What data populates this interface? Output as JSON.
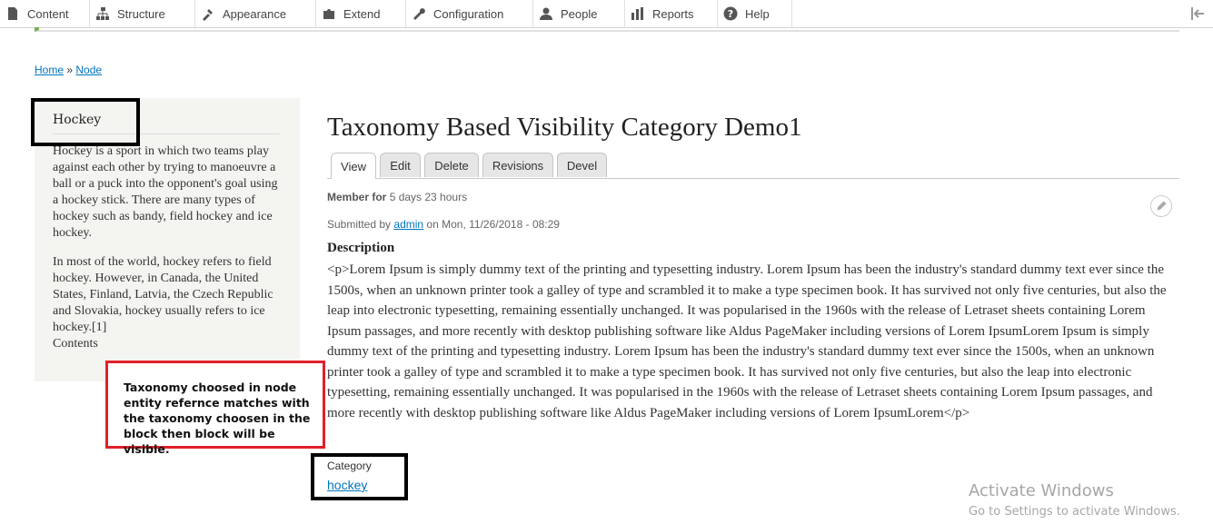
{
  "toolbar": {
    "items": [
      {
        "label": "Content",
        "icon": "file-icon"
      },
      {
        "label": "Structure",
        "icon": "sitemap-icon"
      },
      {
        "label": "Appearance",
        "icon": "paint-icon"
      },
      {
        "label": "Extend",
        "icon": "puzzle-icon"
      },
      {
        "label": "Configuration",
        "icon": "wrench-icon"
      },
      {
        "label": "People",
        "icon": "person-icon"
      },
      {
        "label": "Reports",
        "icon": "bar-chart-icon"
      },
      {
        "label": "Help",
        "icon": "help-icon"
      }
    ]
  },
  "breadcrumb": {
    "home": "Home",
    "sep": "»",
    "node": "Node"
  },
  "sidebar": {
    "title": "Hockey",
    "para1": "Hockey is a sport in which two teams play against each other by trying to manoeuvre a ball or a puck into the opponent's goal using a hockey stick. There are many types of hockey such as bandy, field hockey and ice hockey.",
    "para2": "In most of the world, hockey refers to field hockey. However, in Canada, the United States, Finland, Latvia, the Czech Republic and Slovakia, hockey usually refers to ice hockey.[1]",
    "contents": "Contents"
  },
  "page": {
    "title": "Taxonomy Based Visibility Category Demo1"
  },
  "tabs": [
    "View",
    "Edit",
    "Delete",
    "Revisions",
    "Devel"
  ],
  "meta": {
    "member_label": "Member for",
    "member_value": "5 days 23 hours",
    "submitted_prefix": "Submitted by",
    "author": "admin",
    "submitted_suffix": "on Mon, 11/26/2018 - 08:29"
  },
  "description": {
    "label": "Description",
    "body": "<p>Lorem Ipsum is simply dummy text of the printing and typesetting industry. Lorem Ipsum has been the industry's standard dummy text ever since the 1500s, when an unknown printer took a galley of type and scrambled it to make a type specimen book. It has survived not only five centuries, but also the leap into electronic typesetting, remaining essentially unchanged. It was popularised in the 1960s with the release of Letraset sheets containing Lorem Ipsum passages, and more recently with desktop publishing software like Aldus PageMaker including versions of Lorem IpsumLorem Ipsum is simply dummy text of the printing and typesetting industry. Lorem Ipsum has been the industry's standard dummy text ever since the 1500s, when an unknown printer took a galley of type and scrambled it to make a type specimen book. It has survived not only five centuries, but also the leap into electronic typesetting, remaining essentially unchanged. It was popularised in the 1960s with the release of Letraset sheets containing Lorem Ipsum passages, and more recently with desktop publishing software like Aldus PageMaker including versions of Lorem IpsumLorem</p>"
  },
  "category": {
    "label": "Category",
    "value": "hockey"
  },
  "annotation": {
    "callout": "Taxonomy choosed in node entity refernce matches with the taxonomy choosen in the block then block will be visible."
  },
  "watermark": {
    "line1": "Activate Windows",
    "line2": "Go to Settings to activate Windows."
  },
  "colors": {
    "link": "#0074bd",
    "callout_border": "#e0202a",
    "sidebar_bg": "#f4f4f1",
    "status_bar": "#77b259"
  }
}
